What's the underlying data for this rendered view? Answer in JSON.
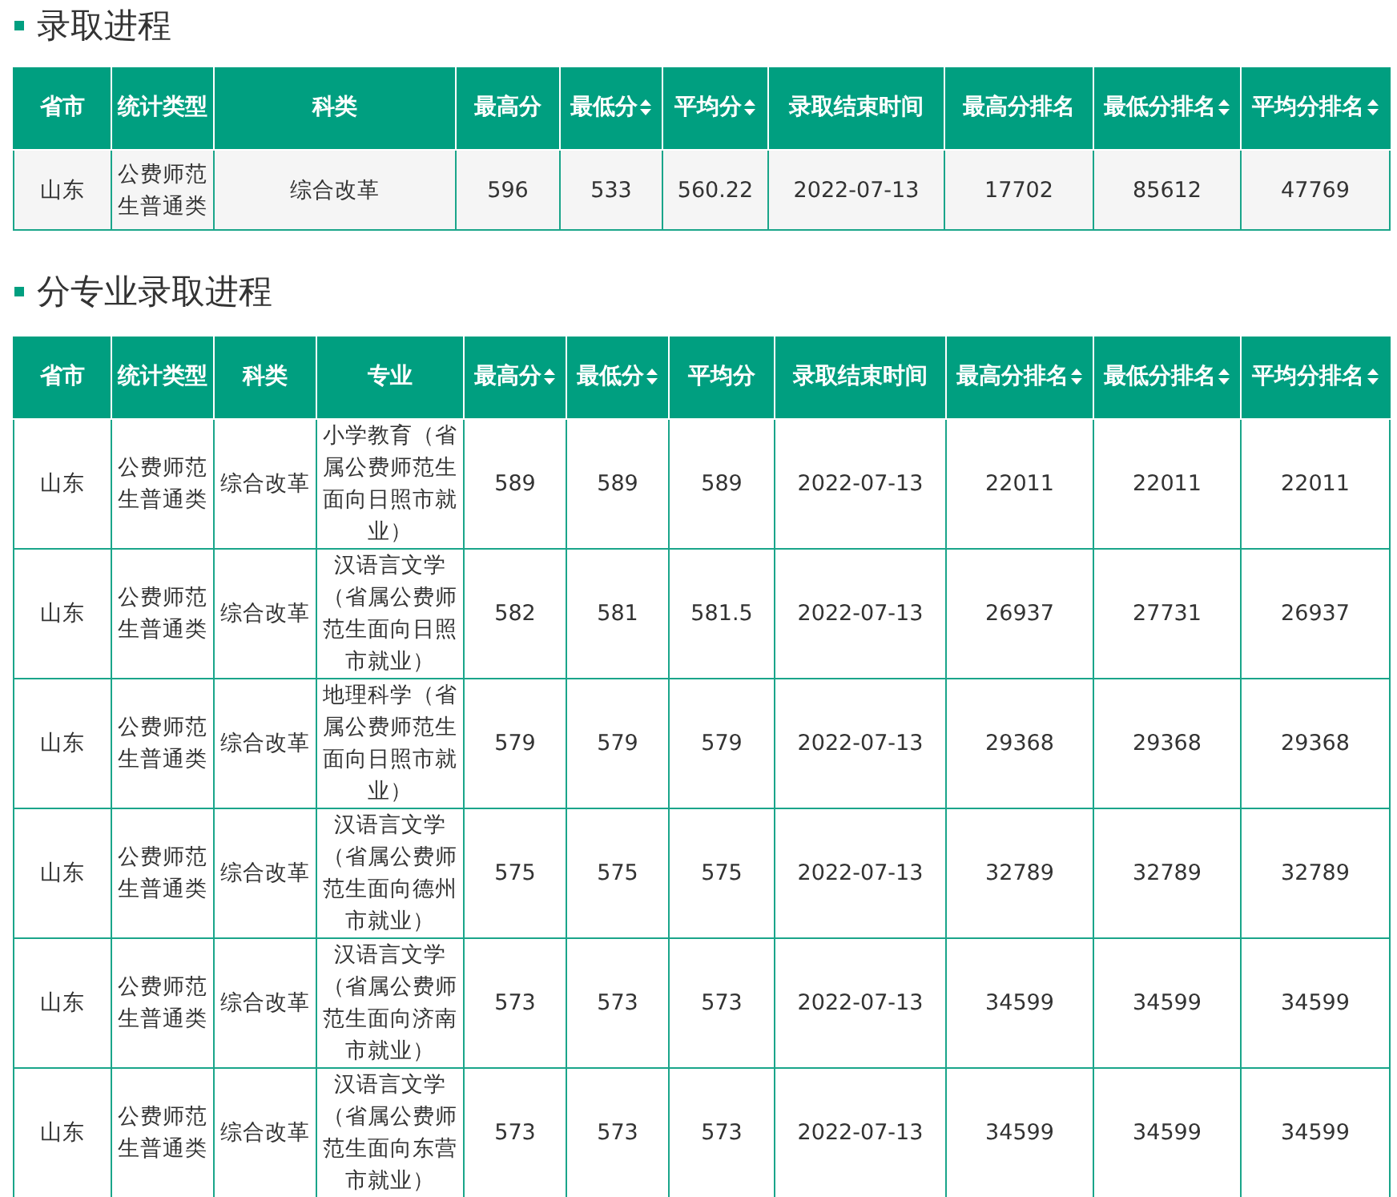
{
  "sections": [
    {
      "title": "录取进程",
      "columns": [
        {
          "label": "省市",
          "sortable": false
        },
        {
          "label": "统计类型",
          "sortable": false
        },
        {
          "label": "科类",
          "sortable": false
        },
        {
          "label": "最高分",
          "sortable": false
        },
        {
          "label": "最低分",
          "sortable": true
        },
        {
          "label": "平均分",
          "sortable": true
        },
        {
          "label": "录取结束时间",
          "sortable": false
        },
        {
          "label": "最高分排名",
          "sortable": false
        },
        {
          "label": "最低分排名",
          "sortable": true
        },
        {
          "label": "平均分排名",
          "sortable": true
        }
      ],
      "rows": [
        [
          "山东",
          "公费师范生普通类",
          "综合改革",
          "596",
          "533",
          "560.22",
          "2022-07-13",
          "17702",
          "85612",
          "47769"
        ]
      ]
    },
    {
      "title": "分专业录取进程",
      "columns": [
        {
          "label": "省市",
          "sortable": false
        },
        {
          "label": "统计类型",
          "sortable": false
        },
        {
          "label": "科类",
          "sortable": false
        },
        {
          "label": "专业",
          "sortable": false
        },
        {
          "label": "最高分",
          "sortable": true
        },
        {
          "label": "最低分",
          "sortable": true
        },
        {
          "label": "平均分",
          "sortable": false
        },
        {
          "label": "录取结束时间",
          "sortable": false
        },
        {
          "label": "最高分排名",
          "sortable": true
        },
        {
          "label": "最低分排名",
          "sortable": true
        },
        {
          "label": "平均分排名",
          "sortable": true
        }
      ],
      "rows": [
        [
          "山东",
          "公费师范生普通类",
          "综合改革",
          "小学教育（省属公费师范生面向日照市就业）",
          "589",
          "589",
          "589",
          "2022-07-13",
          "22011",
          "22011",
          "22011"
        ],
        [
          "山东",
          "公费师范生普通类",
          "综合改革",
          "汉语言文学（省属公费师范生面向日照市就业）",
          "582",
          "581",
          "581.5",
          "2022-07-13",
          "26937",
          "27731",
          "26937"
        ],
        [
          "山东",
          "公费师范生普通类",
          "综合改革",
          "地理科学（省属公费师范生面向日照市就业）",
          "579",
          "579",
          "579",
          "2022-07-13",
          "29368",
          "29368",
          "29368"
        ],
        [
          "山东",
          "公费师范生普通类",
          "综合改革",
          "汉语言文学（省属公费师范生面向德州市就业）",
          "575",
          "575",
          "575",
          "2022-07-13",
          "32789",
          "32789",
          "32789"
        ],
        [
          "山东",
          "公费师范生普通类",
          "综合改革",
          "汉语言文学（省属公费师范生面向济南市就业）",
          "573",
          "573",
          "573",
          "2022-07-13",
          "34599",
          "34599",
          "34599"
        ],
        [
          "山东",
          "公费师范生普通类",
          "综合改革",
          "汉语言文学（省属公费师范生面向东营市就业）",
          "573",
          "573",
          "573",
          "2022-07-13",
          "34599",
          "34599",
          "34599"
        ]
      ]
    }
  ]
}
